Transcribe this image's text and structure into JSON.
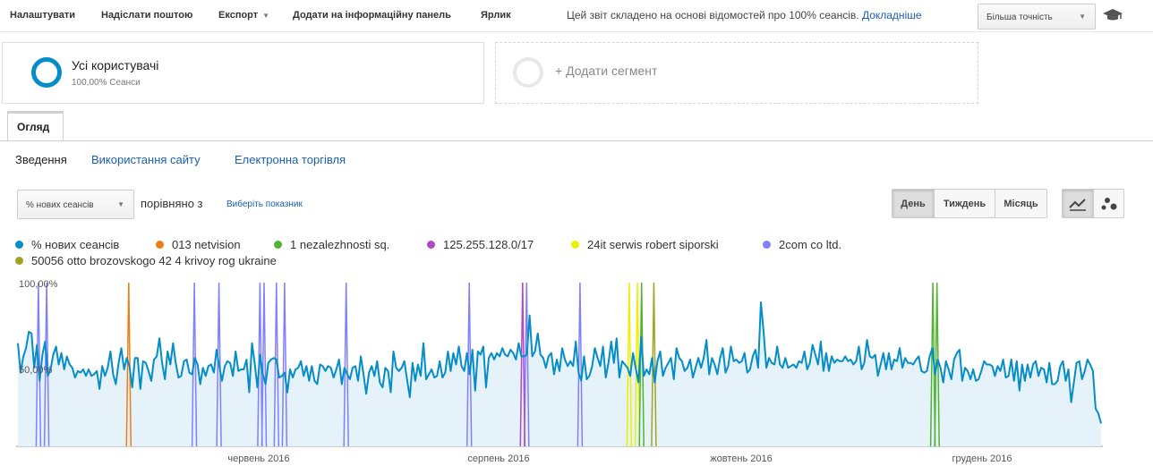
{
  "toolbar": {
    "items": [
      {
        "label": "Налаштувати"
      },
      {
        "label": "Надіслати поштою"
      },
      {
        "label": "Експорт"
      },
      {
        "label": "Додати на інформаційну панель"
      },
      {
        "label": "Ярлик"
      }
    ],
    "notice": "Цей звіт складено на основі відомостей про 100% сеансів.",
    "notice_link": "Докладніше",
    "precision": "Більша точність"
  },
  "segments": {
    "active": {
      "title": "Усі користувачі",
      "subtitle": "100,00% Сеанси"
    },
    "add_label": "+ Додати сегмент"
  },
  "tabs": {
    "active": "Огляд"
  },
  "subnav": [
    "Зведення",
    "Використання сайту",
    "Електронна торгівля"
  ],
  "metric": {
    "selected": "% нових сеансів",
    "compare_label": "порівняно з",
    "choose_label": "Виберіть показник"
  },
  "period_buttons": [
    "День",
    "Тиждень",
    "Місяць"
  ],
  "legend": [
    {
      "label": "% нових сеансів",
      "color": "#058dc7"
    },
    {
      "label": "013 netvision",
      "color": "#ed7e17"
    },
    {
      "label": "1 nezalezhnosti sq.",
      "color": "#50b432"
    },
    {
      "label": "125.255.128.0/17",
      "color": "#af49c5"
    },
    {
      "label": "24it serwis robert siporski",
      "color": "#edef00"
    },
    {
      "label": "2com co ltd.",
      "color": "#8080ff"
    },
    {
      "label": "50056 otto brozovskogo 42 4 krivoy rog ukraine",
      "color": "#a0a424"
    }
  ],
  "chart_data": {
    "type": "line",
    "y_ticks": [
      "100,00%",
      "50,00%"
    ],
    "ylim": [
      0,
      100
    ],
    "x_tick_labels": [
      "червень 2016",
      "серпень 2016",
      "жовтень 2016",
      "грудень 2016"
    ],
    "x": [
      "2016-04-12",
      "2017-01-01"
    ],
    "series": [
      {
        "name": "% нових сеансів",
        "color": "#058dc7",
        "values": [
          63,
          45,
          55,
          60,
          70,
          69,
          48,
          62,
          40,
          56,
          64,
          43,
          47,
          56,
          61,
          50,
          57,
          47,
          55,
          50,
          48,
          42,
          46,
          45,
          47,
          43,
          47,
          43,
          44,
          46,
          35,
          49,
          43,
          48,
          58,
          44,
          38,
          51,
          60,
          47,
          54,
          49,
          36,
          54,
          54,
          35,
          52,
          51,
          46,
          40,
          53,
          55,
          66,
          51,
          41,
          58,
          50,
          63,
          51,
          42,
          43,
          52,
          53,
          45,
          44,
          54,
          50,
          38,
          48,
          43,
          49,
          50,
          45,
          59,
          49,
          40,
          49,
          52,
          51,
          43,
          58,
          46,
          47,
          47,
          53,
          33,
          63,
          51,
          36,
          56,
          44,
          38,
          51,
          53,
          54,
          53,
          42,
          43,
          45,
          33,
          47,
          42,
          47,
          48,
          52,
          43,
          49,
          40,
          49,
          40,
          38,
          50,
          49,
          46,
          49,
          48,
          42,
          47,
          53,
          38,
          48,
          44,
          41,
          48,
          49,
          40,
          55,
          44,
          32,
          45,
          49,
          43,
          52,
          39,
          36,
          48,
          46,
          33,
          58,
          48,
          46,
          48,
          52,
          41,
          30,
          51,
          40,
          50,
          43,
          63,
          41,
          44,
          47,
          42,
          43,
          52,
          42,
          45,
          58,
          46,
          57,
          50,
          61,
          49,
          46,
          57,
          44,
          59,
          34,
          58,
          56,
          61,
          36,
          54,
          57,
          53,
          57,
          55,
          60,
          56,
          55,
          59,
          57,
          53,
          63,
          55,
          55,
          56,
          80,
          55,
          58,
          69,
          56,
          54,
          48,
          55,
          57,
          44,
          53,
          46,
          60,
          53,
          49,
          52,
          49,
          64,
          45,
          40,
          55,
          41,
          43,
          49,
          60,
          54,
          49,
          61,
          42,
          51,
          64,
          51,
          66,
          42,
          52,
          50,
          48,
          43,
          57,
          48,
          39,
          67,
          43,
          47,
          44,
          54,
          39,
          52,
          58,
          43,
          48,
          51,
          54,
          41,
          60,
          54,
          52,
          46,
          48,
          53,
          42,
          48,
          54,
          48,
          54,
          65,
          44,
          54,
          50,
          44,
          54,
          60,
          45,
          49,
          61,
          52,
          53,
          51,
          52,
          57,
          45,
          47,
          55,
          59,
          48,
          88,
          70,
          48,
          54,
          51,
          50,
          61,
          50,
          48,
          54,
          48,
          49,
          50,
          48,
          52,
          51,
          58,
          47,
          51,
          62,
          56,
          50,
          64,
          46,
          57,
          46,
          55,
          51,
          53,
          52,
          52,
          55,
          52,
          53,
          50,
          52,
          61,
          47,
          51,
          65,
          55,
          54,
          56,
          43,
          50,
          57,
          47,
          57,
          47,
          53,
          52,
          60,
          48,
          54,
          51,
          51,
          50,
          53,
          55,
          46,
          45,
          46,
          55,
          60,
          44,
          53,
          48,
          39,
          52,
          47,
          41,
          53,
          57,
          59,
          40,
          48,
          46,
          41,
          47,
          40,
          41,
          46,
          52,
          50,
          50,
          49,
          43,
          49,
          46,
          53,
          42,
          43,
          53,
          40,
          52,
          34,
          50,
          40,
          50,
          42,
          50,
          52,
          43,
          48,
          47,
          39,
          51,
          38,
          38,
          40,
          49,
          52,
          40,
          47,
          27,
          39,
          51,
          52,
          41,
          46,
          53,
          50,
          46,
          23,
          20,
          14
        ]
      }
    ],
    "spike_series": [
      {
        "name": "2com co ltd.",
        "color": "#8080ff",
        "dates": [
          "2016-04-17",
          "2016-04-19",
          "2016-05-25",
          "2016-05-31",
          "2016-06-10",
          "2016-06-11",
          "2016-06-14",
          "2016-06-16",
          "2016-07-01",
          "2016-07-31",
          "2016-08-14",
          "2016-08-27"
        ]
      },
      {
        "name": "013 netvision",
        "color": "#ed7e17",
        "dates": [
          "2016-05-09"
        ]
      },
      {
        "name": "125.255.128.0/17",
        "color": "#af49c5",
        "dates": [
          "2016-08-13"
        ]
      },
      {
        "name": "24it serwis robert siporski",
        "color": "#edef00",
        "dates": [
          "2016-09-08",
          "2016-09-10"
        ]
      },
      {
        "name": "1 nezalezhnosti sq.",
        "color": "#50b432",
        "dates": [
          "2016-09-11",
          "2016-11-21",
          "2016-11-22"
        ]
      },
      {
        "name": "50056 otto brozovskogo 42 4 krivoy rog ukraine",
        "color": "#a0a424",
        "dates": [
          "2016-09-14"
        ]
      }
    ]
  }
}
